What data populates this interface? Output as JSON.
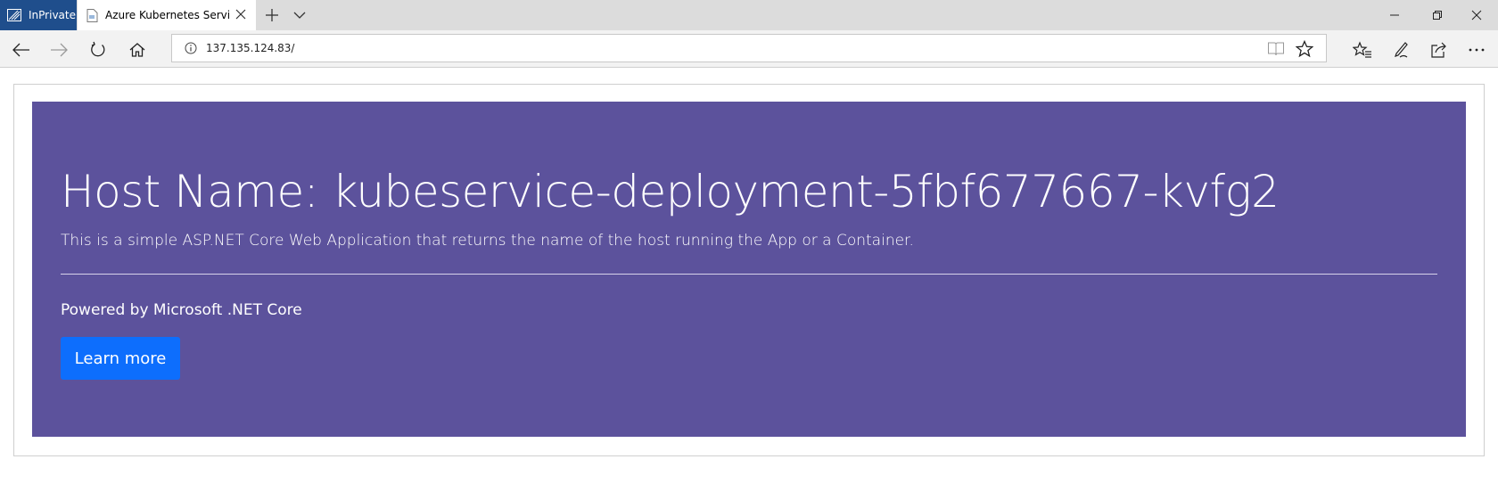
{
  "browser": {
    "inprivate_label": "InPrivate",
    "tab_title": "Azure Kubernetes Servic",
    "address": "137.135.124.83/"
  },
  "page": {
    "host_title": "Host Name: kubeservice-deployment-5fbf677667-kvfg2",
    "lead": "This is a simple ASP.NET Core Web Application that returns the name of the host running the App or a Container.",
    "powered": "Powered by Microsoft .NET Core",
    "learn_more": "Learn more"
  },
  "colors": {
    "jumbotron_bg": "#5c529c",
    "button_bg": "#0d6efd",
    "inprivate_bg": "#1f4e8c"
  },
  "icons": [
    "inprivate-icon",
    "page-icon",
    "close-icon",
    "plus-icon",
    "chevron-down-icon",
    "minimize-icon",
    "maximize-icon",
    "back-arrow-icon",
    "forward-arrow-icon",
    "refresh-icon",
    "home-icon",
    "info-icon",
    "reading-view-icon",
    "star-icon",
    "favorites-icon",
    "pen-icon",
    "share-icon",
    "more-icon"
  ]
}
